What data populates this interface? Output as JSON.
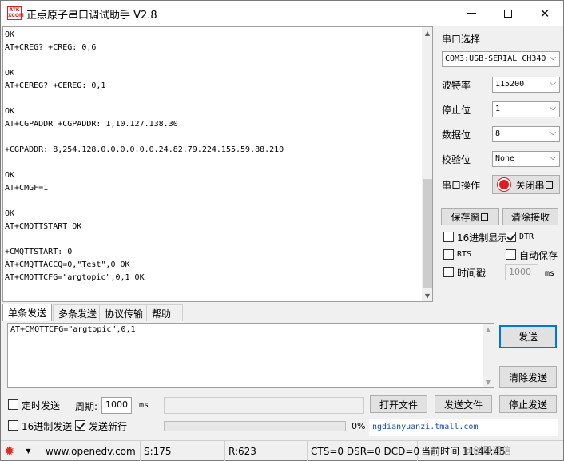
{
  "window": {
    "title": "正点原子串口调试助手 V2.8",
    "icon_line1": "ATK",
    "icon_line2": "XCOM",
    "icon_name": "atk-xcom-icon"
  },
  "receive": {
    "lines": [
      "OK",
      "AT+CREG? +CREG: 0,6",
      "",
      "OK",
      "AT+CEREG? +CEREG: 0,1",
      "",
      "OK",
      "AT+CGPADDR +CGPADDR: 1,10.127.138.30",
      "",
      "+CGPADDR: 8,254.128.0.0.0.0.0.0.24.82.79.224.155.59.88.210",
      "",
      "OK",
      "AT+CMGF=1",
      "",
      "OK",
      "AT+CMQTTSTART OK",
      "",
      "+CMQTTSTART: 0",
      "AT+CMQTTACCQ=0,\"Test\",0 OK",
      "AT+CMQTTCFG=\"argtopic\",0,1 OK"
    ]
  },
  "settings": {
    "port_label": "串口选择",
    "port_value": "COM3:USB-SERIAL CH340",
    "baud_label": "波特率",
    "baud_value": "115200",
    "stopbits_label": "停止位",
    "stopbits_value": "1",
    "databits_label": "数据位",
    "databits_value": "8",
    "parity_label": "校验位",
    "parity_value": "None",
    "serial_op_label": "串口操作",
    "close_port_label": "关闭串口",
    "save_window_label": "保存窗口",
    "clear_recv_label": "清除接收",
    "hex_display_label": "16进制显示",
    "dtr_label": "DTR",
    "rts_label": "RTS",
    "auto_save_label": "自动保存",
    "timestamp_label": "时间戳",
    "timestamp_ms_value": "1000",
    "timestamp_unit": "ms",
    "hex_display_checked": false,
    "dtr_checked": true,
    "rts_checked": false,
    "auto_save_checked": false,
    "timestamp_checked": false
  },
  "tabs": [
    "单条发送",
    "多条发送",
    "协议传输",
    "帮助"
  ],
  "send": {
    "text": "AT+CMQTTCFG=\"argtopic\",0,1",
    "send_label": "发送",
    "clear_send_label": "清除发送",
    "timed_send_label": "定时发送",
    "period_label": "周期:",
    "period_value": "1000",
    "period_unit": "ms",
    "open_file_label": "打开文件",
    "send_file_label": "发送文件",
    "stop_send_label": "停止发送",
    "hex_send_label": "16进制发送",
    "send_newline_label": "发送新行",
    "timed_send_checked": false,
    "hex_send_checked": false,
    "send_newline_checked": true,
    "progress_percent": 0,
    "progress_text": "0%",
    "link_text": "ngdianyuanzi.tmall.com"
  },
  "statusbar": {
    "website": "www.openedv.com",
    "sent": "S:175",
    "received": "R:623",
    "signals": "CTS=0 DSR=0 DCD=0",
    "time": "当前时间 11:44:45",
    "watermark": "@创思通信"
  },
  "colors": {
    "accent": "#0078d7",
    "record_red": "#e11b1b",
    "gear_red": "#d9301e",
    "link_blue": "#1a4db3"
  }
}
